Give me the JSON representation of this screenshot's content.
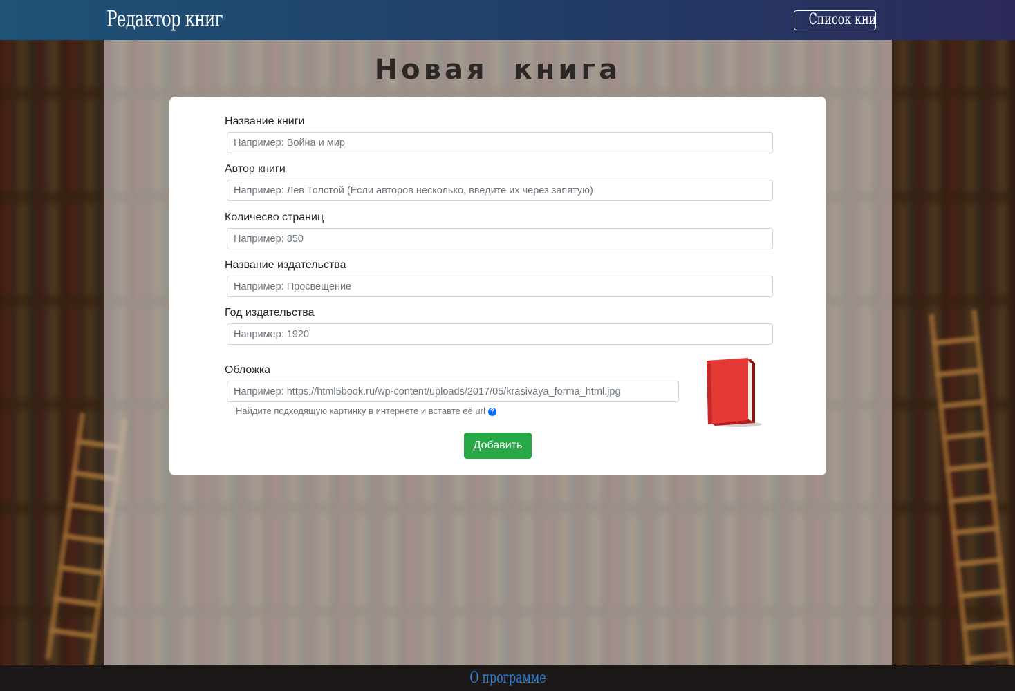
{
  "header": {
    "brand": "Редактор книг",
    "list_button": "Список книг"
  },
  "page": {
    "title": "Новая книга"
  },
  "form": {
    "fields": [
      {
        "label": "Название книги",
        "placeholder": "Например: Война и мир"
      },
      {
        "label": "Автор книги",
        "placeholder": "Например: Лев Толстой (Если авторов несколько, введите их через запятую)"
      },
      {
        "label": "Количесво страниц",
        "placeholder": "Например: 850"
      },
      {
        "label": "Название издательства",
        "placeholder": "Например: Просвещение"
      },
      {
        "label": "Год издательства",
        "placeholder": "Например: 1920"
      }
    ],
    "cover": {
      "label": "Обложка",
      "placeholder": "Например: https://html5book.ru/wp-content/uploads/2017/05/krasivaya_forma_html.jpg",
      "help": "Найдите подходящую картинку в интернете и вставте её url",
      "help_icon": "?"
    },
    "submit_label": "Добавить"
  },
  "footer": {
    "link": "О программе"
  },
  "colors": {
    "accent_green": "#28a745",
    "header_start": "#1e5277",
    "header_end": "#2c2a58",
    "footer_link": "#2d7fd8",
    "book_red": "#e53935"
  }
}
